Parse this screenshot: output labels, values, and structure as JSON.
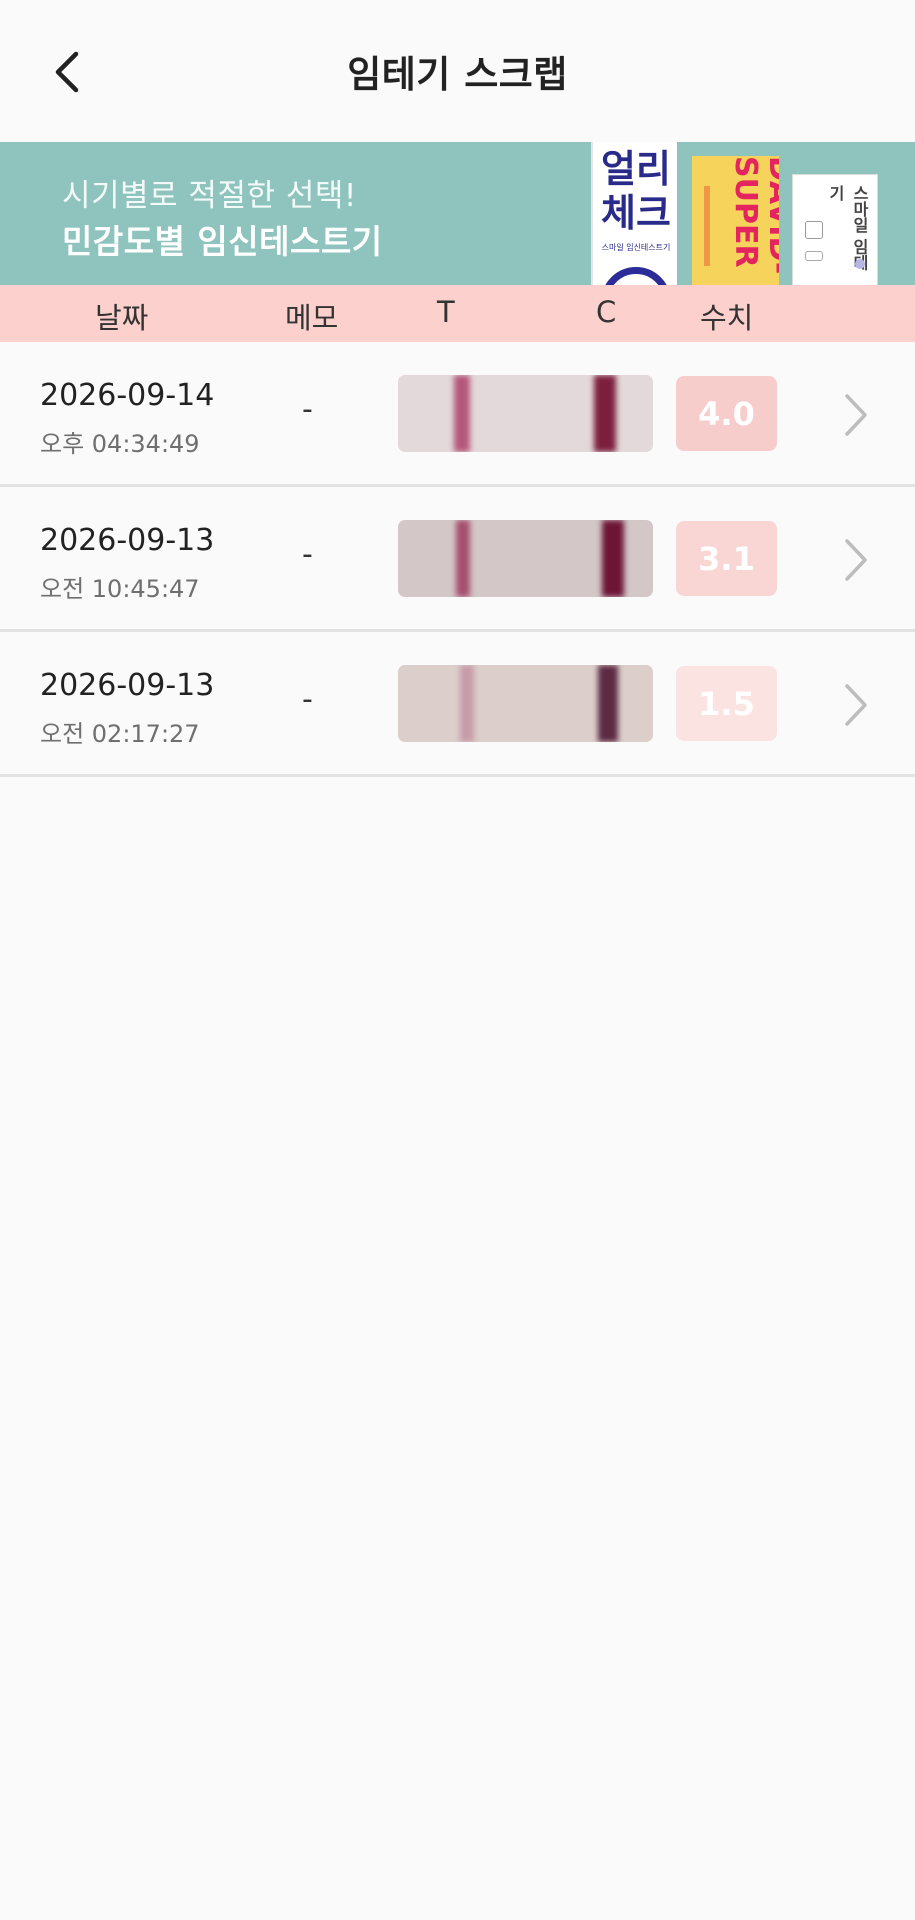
{
  "header": {
    "title": "임테기 스크랩"
  },
  "banner": {
    "subtitle": "시기별로 적절한 선택!",
    "headline": "민감도별 임신테스트기",
    "products": [
      {
        "name_line1": "얼리",
        "name_line2": "체크",
        "tagline": "스마일 임신테스트기"
      },
      {
        "name": "DAVID-SUPER"
      },
      {
        "name": "스마일 임테기"
      }
    ]
  },
  "columns": {
    "date": "날짜",
    "memo": "메모",
    "t": "T",
    "c": "C",
    "value": "수치"
  },
  "rows": [
    {
      "date": "2026-09-14",
      "time": "오후 04:34:49",
      "memo": "-",
      "value": "4.0",
      "badge_color": "#f7cdcb",
      "strip_bg": "#e3d9da",
      "t_line_color": "#b5577a",
      "c_line_color": "#7c1f3e"
    },
    {
      "date": "2026-09-13",
      "time": "오전 10:45:47",
      "memo": "-",
      "value": "3.1",
      "badge_color": "#f9d6d4",
      "strip_bg": "#d3c7c8",
      "t_line_color": "#a54e6e",
      "c_line_color": "#6c1535"
    },
    {
      "date": "2026-09-13",
      "time": "오전 02:17:27",
      "memo": "-",
      "value": "1.5",
      "badge_color": "#fbe3e2",
      "strip_bg": "#dccfcb",
      "t_line_color": "#c79aa8",
      "c_line_color": "#5c2a43"
    }
  ]
}
